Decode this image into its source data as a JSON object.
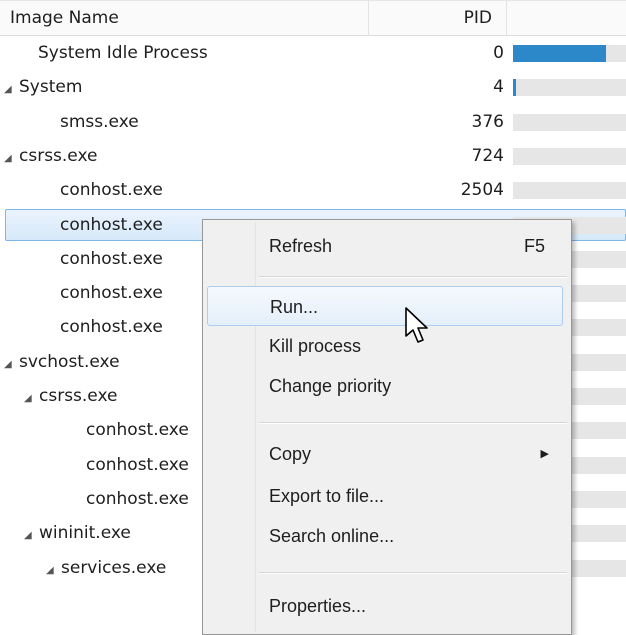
{
  "header": {
    "name_col": "Image Name",
    "pid_col": "PID"
  },
  "rows": [
    {
      "name": "System Idle Process",
      "pid": "0",
      "indent": 1,
      "expander": "",
      "cpu_fraction": 0.82
    },
    {
      "name": "System",
      "pid": "4",
      "indent": 0,
      "expander": "◢",
      "cpu_fraction": 0.02
    },
    {
      "name": "smss.exe",
      "pid": "376",
      "indent": 2,
      "expander": "",
      "cpu_fraction": 0
    },
    {
      "name": "csrss.exe",
      "pid": "724",
      "indent": 0,
      "expander": "◢",
      "cpu_fraction": 0
    },
    {
      "name": "conhost.exe",
      "pid": "2504",
      "indent": 2,
      "expander": "",
      "cpu_fraction": 0,
      "selected": true
    },
    {
      "name": "conhost.exe",
      "pid": "",
      "indent": 2,
      "expander": "",
      "cpu_fraction": 0
    },
    {
      "name": "conhost.exe",
      "pid": "",
      "indent": 2,
      "expander": "",
      "cpu_fraction": 0
    },
    {
      "name": "conhost.exe",
      "pid": "",
      "indent": 2,
      "expander": "",
      "cpu_fraction": 0
    },
    {
      "name": "conhost.exe",
      "pid": "",
      "indent": 2,
      "expander": "",
      "cpu_fraction": 0
    },
    {
      "name": "svchost.exe",
      "pid": "",
      "indent": 0,
      "expander": "◢",
      "cpu_fraction": 0
    },
    {
      "name": "csrss.exe",
      "pid": "",
      "indent": 1,
      "expander": "◢",
      "cpu_fraction": 0
    },
    {
      "name": "conhost.exe",
      "pid": "",
      "indent": 3,
      "expander": "",
      "cpu_fraction": 0
    },
    {
      "name": "conhost.exe",
      "pid": "",
      "indent": 3,
      "expander": "",
      "cpu_fraction": 0
    },
    {
      "name": "conhost.exe",
      "pid": "",
      "indent": 3,
      "expander": "",
      "cpu_fraction": 0
    },
    {
      "name": "wininit.exe",
      "pid": "",
      "indent": 1,
      "expander": "◢",
      "cpu_fraction": 0
    },
    {
      "name": "services.exe",
      "pid": "",
      "indent": 2,
      "expander": "◢",
      "cpu_fraction": 0
    }
  ],
  "context_menu": {
    "items": [
      {
        "label": "Refresh",
        "shortcut": "F5"
      },
      {
        "label": "Run...",
        "hover": true
      },
      {
        "label": "Kill process"
      },
      {
        "label": "Change priority"
      },
      {
        "label": "Copy",
        "submenu": true
      },
      {
        "label": "Export to file..."
      },
      {
        "label": "Search online..."
      },
      {
        "label": "Properties..."
      }
    ]
  },
  "colors": {
    "cpu_bar": "#2c88c9",
    "selection_border": "#7db6e7"
  },
  "icons": {
    "expander": "triangle-expanded-icon",
    "submenu": "submenu-arrow-icon",
    "cursor": "mouse-pointer-icon"
  }
}
